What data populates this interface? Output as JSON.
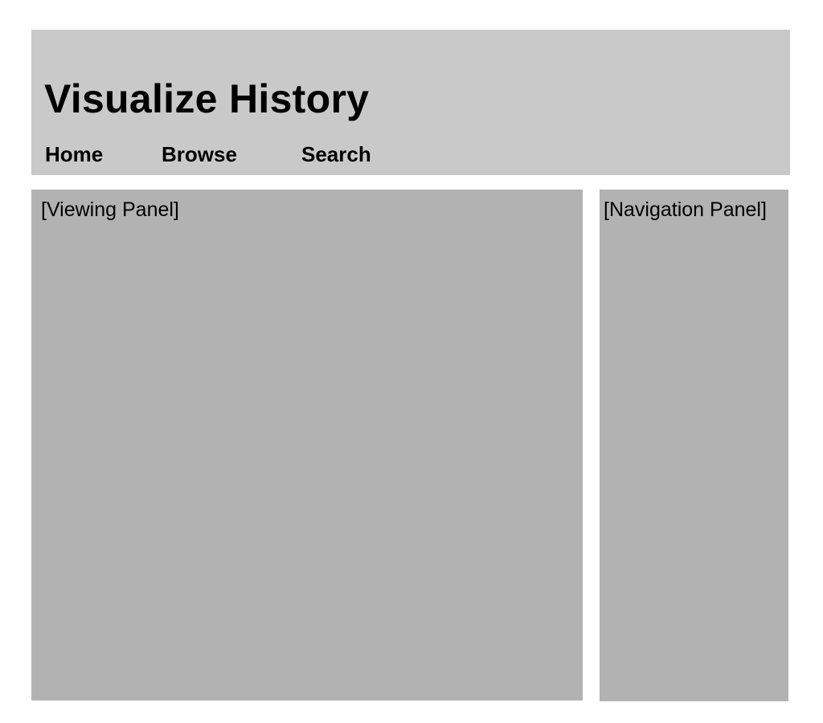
{
  "header": {
    "title": "Visualize History",
    "background": "#c9c9c9",
    "nav": [
      {
        "label": "Home"
      },
      {
        "label": "Browse"
      },
      {
        "label": "Search"
      }
    ]
  },
  "viewing_panel": {
    "label": "[Viewing Panel]",
    "background": "#b2b2b2"
  },
  "navigation_panel": {
    "label": "[Navigation Panel]",
    "background": "#b2b2b2"
  }
}
